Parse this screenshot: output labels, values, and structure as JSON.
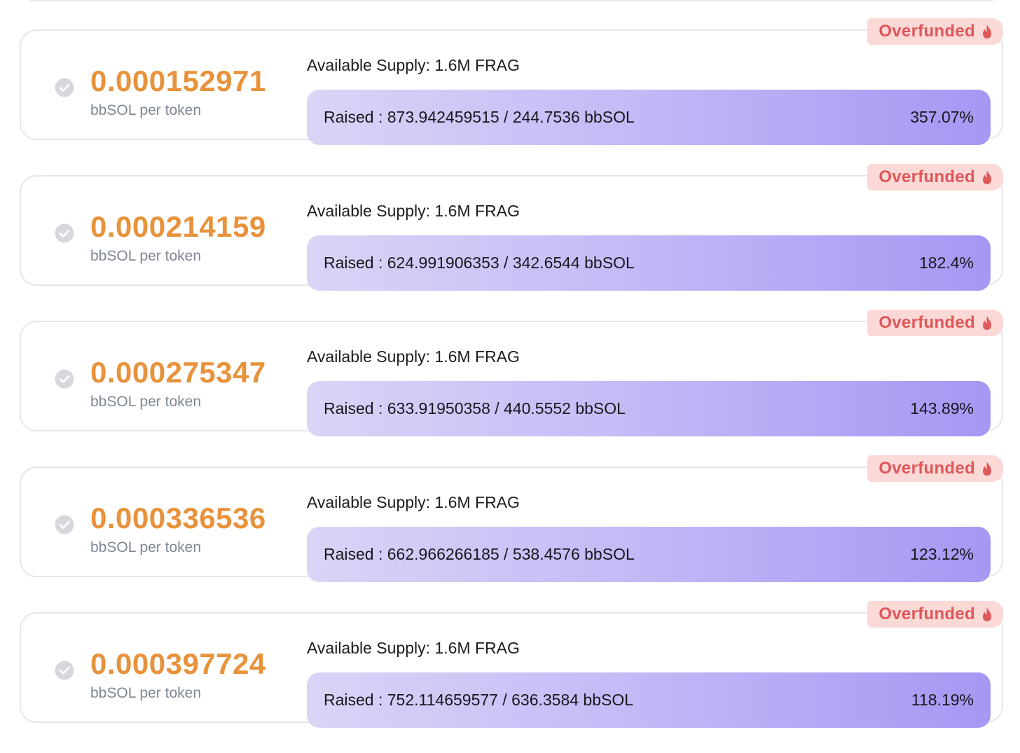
{
  "colors": {
    "price": "#e8923b",
    "badge_bg": "#fbd9d6",
    "badge_text": "#e0575a",
    "progress_start": "#dbd4f6",
    "progress_end": "#a697f3",
    "card_border": "#e4e7ec"
  },
  "icons": {
    "status": "check-circle-icon",
    "badge": "flame-icon"
  },
  "tiers": [
    {
      "badge": "Overfunded",
      "price": "0.000152971",
      "price_unit": "bbSOL per token",
      "supply": "Available Supply: 1.6M FRAG",
      "raised": "Raised : 873.942459515 / 244.7536 bbSOL",
      "percent": "357.07%",
      "progress_fraction": 1.0
    },
    {
      "badge": "Overfunded",
      "price": "0.000214159",
      "price_unit": "bbSOL per token",
      "supply": "Available Supply: 1.6M FRAG",
      "raised": "Raised : 624.991906353 / 342.6544 bbSOL",
      "percent": "182.4%",
      "progress_fraction": 1.0
    },
    {
      "badge": "Overfunded",
      "price": "0.000275347",
      "price_unit": "bbSOL per token",
      "supply": "Available Supply: 1.6M FRAG",
      "raised": "Raised : 633.91950358 / 440.5552 bbSOL",
      "percent": "143.89%",
      "progress_fraction": 1.0
    },
    {
      "badge": "Overfunded",
      "price": "0.000336536",
      "price_unit": "bbSOL per token",
      "supply": "Available Supply: 1.6M FRAG",
      "raised": "Raised : 662.966266185 / 538.4576 bbSOL",
      "percent": "123.12%",
      "progress_fraction": 1.0
    },
    {
      "badge": "Overfunded",
      "price": "0.000397724",
      "price_unit": "bbSOL per token",
      "supply": "Available Supply: 1.6M FRAG",
      "raised": "Raised : 752.114659577 / 636.3584 bbSOL",
      "percent": "118.19%",
      "progress_fraction": 1.0
    }
  ]
}
